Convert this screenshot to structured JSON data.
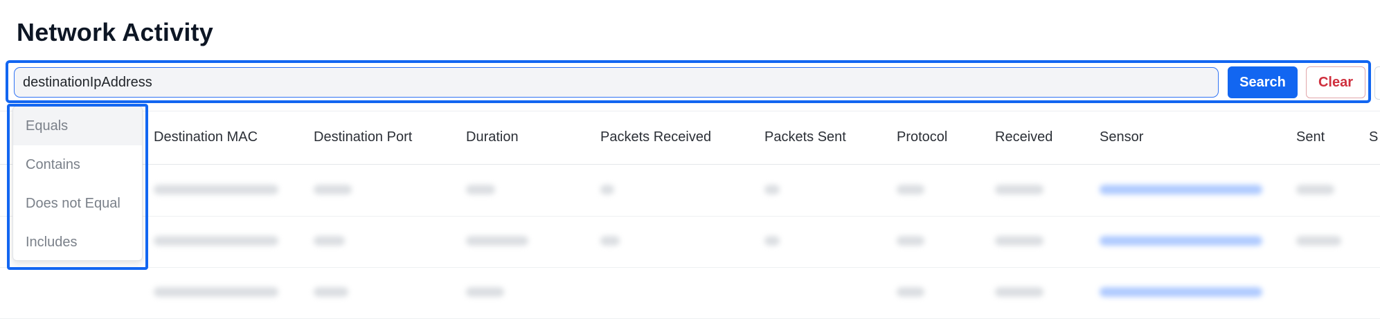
{
  "page": {
    "title": "Network Activity"
  },
  "search": {
    "value": "destinationIpAddress",
    "search_label": "Search",
    "clear_label": "Clear"
  },
  "dropdown": {
    "options": [
      "Equals",
      "Contains",
      "Does not Equal",
      "Includes"
    ],
    "highlighted": "Equals"
  },
  "table": {
    "columns": [
      "Destination MAC",
      "Destination Port",
      "Duration",
      "Packets Received",
      "Packets Sent",
      "Protocol",
      "Received",
      "Sensor",
      "Sent",
      "S"
    ]
  },
  "colors": {
    "accent": "#1266f1",
    "danger": "#cf2f3d",
    "link": "#7aa7ff"
  }
}
